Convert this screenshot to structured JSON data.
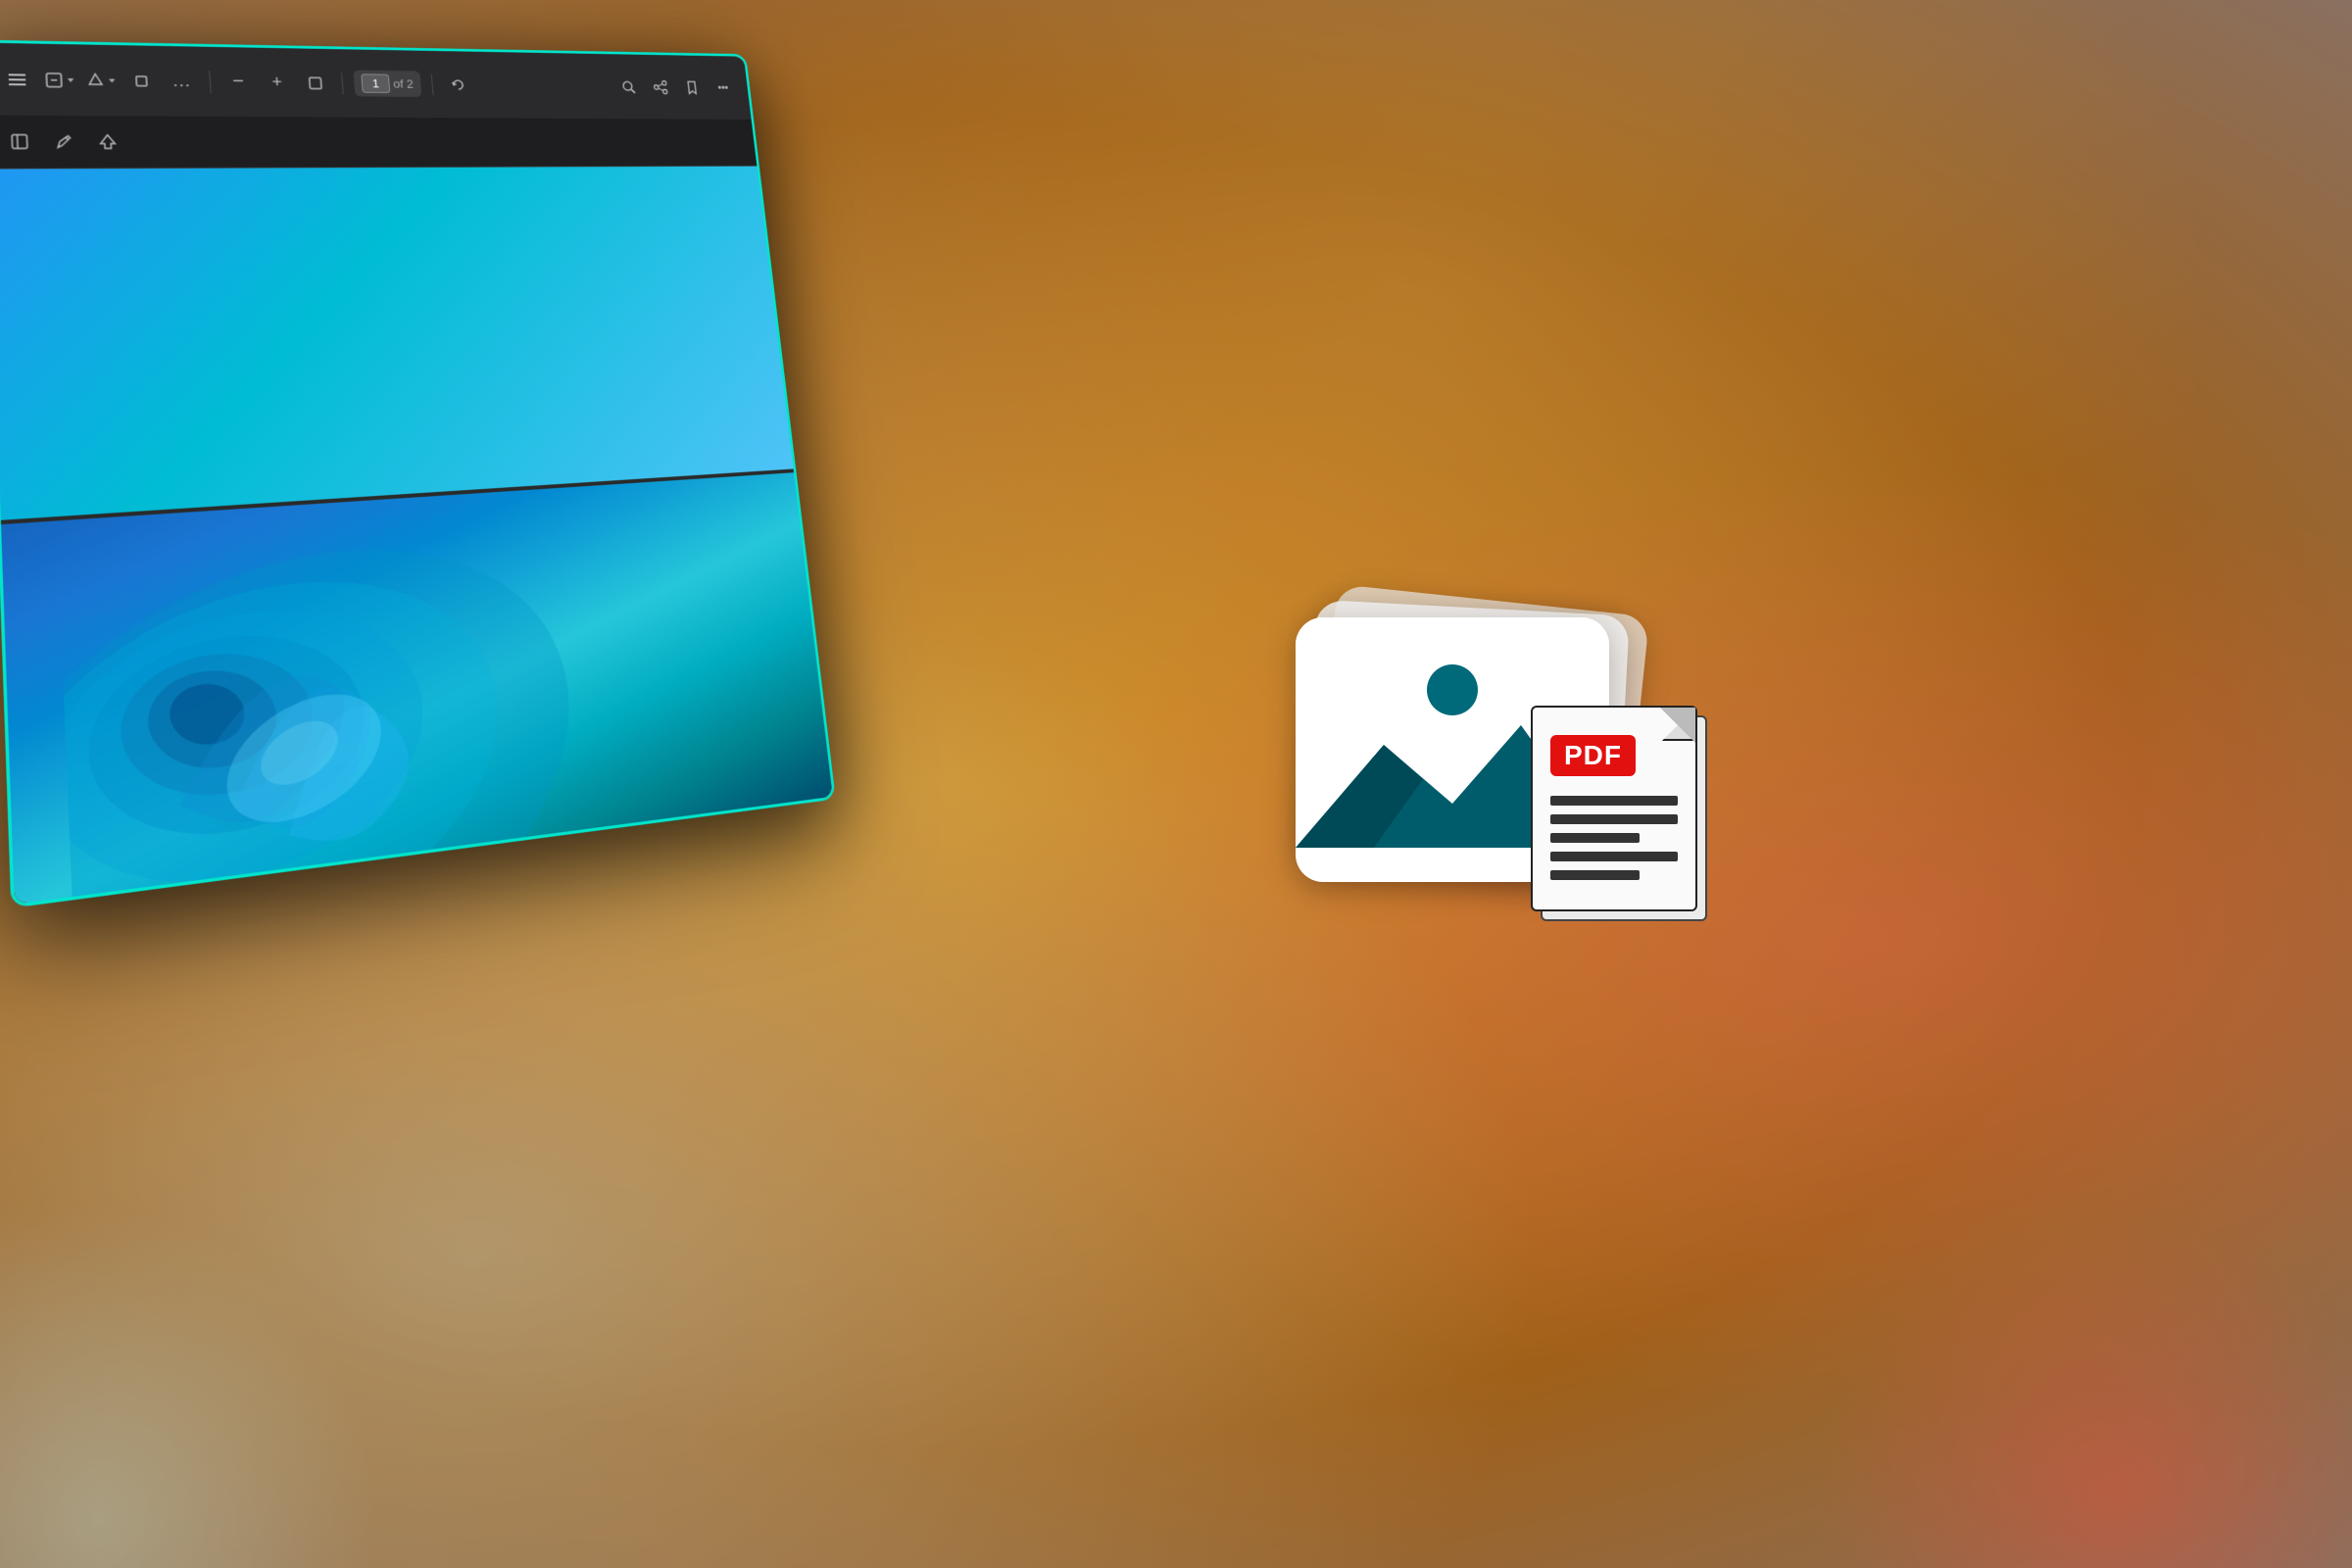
{
  "background": {
    "color_main": "#c8882a",
    "color_secondary": "#a06018"
  },
  "toolbar": {
    "current_page": "1",
    "total_pages": "of 2",
    "zoom_in_label": "+",
    "zoom_out_label": "−",
    "more_label": "...",
    "fit_page_label": "⬜",
    "rotate_label": "↺",
    "bookmark_label": "📑"
  },
  "toolbar2": {
    "menu_label": "☰",
    "annotation_label": "✏",
    "highlight_label": "▼",
    "search_label": "🔍",
    "view_label": "⊞"
  },
  "icons": {
    "photo_stack_icon": "photo-stack",
    "pdf_badge_text": "PDF",
    "document_icon": "pdf-document"
  },
  "window": {
    "border_color": "#00e5cc"
  }
}
